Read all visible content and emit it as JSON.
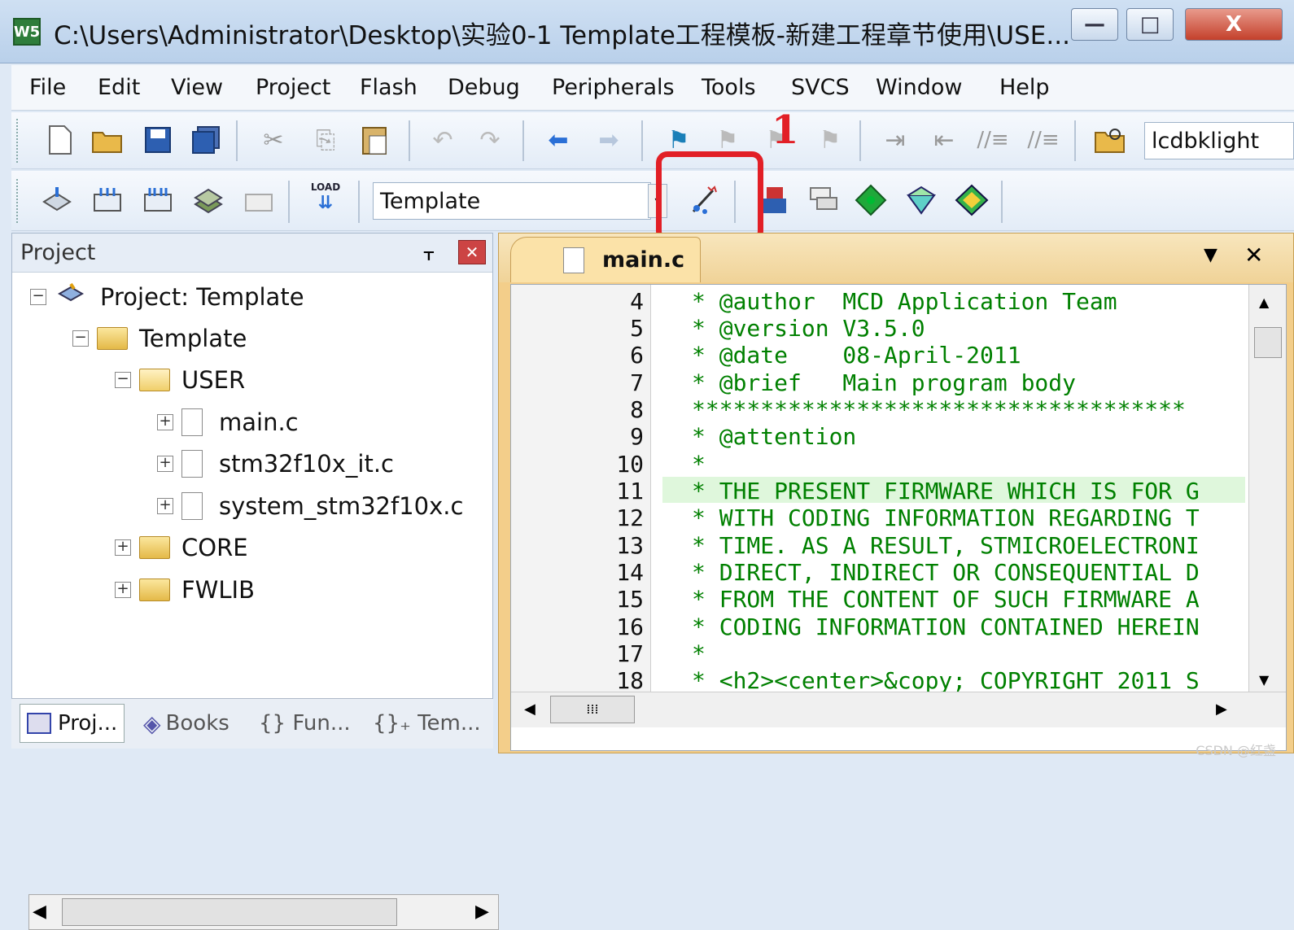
{
  "window": {
    "title": "C:\\Users\\Administrator\\Desktop\\实验0-1 Template工程模板-新建工程章节使用\\USE...",
    "app_icon_label": "W5",
    "minimize": "—",
    "maximize": "□",
    "close": "X"
  },
  "menu": [
    "File",
    "Edit",
    "View",
    "Project",
    "Flash",
    "Debug",
    "Peripherals",
    "Tools",
    "SVCS",
    "Window",
    "Help"
  ],
  "toolbar1": {
    "find_combo_value": "lcdbklight",
    "icons": [
      "new-file",
      "open-folder",
      "save",
      "save-all",
      "cut",
      "copy",
      "paste",
      "undo",
      "redo",
      "nav-back",
      "nav-forward",
      "bookmark-set",
      "bookmark-prev",
      "bookmark-next",
      "bookmark-clear",
      "indent",
      "unindent",
      "comment",
      "uncomment",
      "find-in-files"
    ]
  },
  "toolbar2": {
    "target_combo_value": "Template",
    "load_label": "LOAD",
    "annotation_number": "1",
    "icons": [
      "translate",
      "build",
      "rebuild",
      "batch-build",
      "stop-build",
      "download",
      "target-options",
      "file-extensions",
      "manage-run-time",
      "select-packs",
      "pack-installer",
      "manage-components"
    ]
  },
  "project_panel": {
    "title": "Project",
    "pin": "ᚁ",
    "close": "✕",
    "tree": [
      {
        "label": "Project: Template",
        "expander": "⊟"
      },
      {
        "label": "Template",
        "expander": "⊟"
      },
      {
        "label": "USER",
        "expander": "⊟"
      },
      {
        "label": "main.c",
        "expander": "+"
      },
      {
        "label": "stm32f10x_it.c",
        "expander": "+"
      },
      {
        "label": "system_stm32f10x.c",
        "expander": "+"
      },
      {
        "label": "CORE",
        "expander": "+"
      },
      {
        "label": "FWLIB",
        "expander": "+"
      }
    ],
    "tabs": [
      "Proj...",
      "Books",
      "{} Fun...",
      "{}₊ Tem..."
    ]
  },
  "editor": {
    "tab_label": "main.c",
    "dropdown_glyph": "▼",
    "close_glyph": "✕",
    "line_numbers": [
      "4",
      "5",
      "6",
      "7",
      "8",
      "9",
      "10",
      "11",
      "12",
      "13",
      "14",
      "15",
      "16",
      "17",
      "18"
    ],
    "lines": [
      "* @author  MCD Application Team",
      "* @version V3.5.0",
      "* @date    08-April-2011",
      "* @brief   Main program body",
      "************************************",
      "* @attention",
      "*",
      "* THE PRESENT FIRMWARE WHICH IS FOR G",
      "* WITH CODING INFORMATION REGARDING T",
      "* TIME. AS A RESULT, STMICROELECTRONI",
      "* DIRECT, INDIRECT OR CONSEQUENTIAL D",
      "* FROM THE CONTENT OF SUCH FIRMWARE A",
      "* CODING INFORMATION CONTAINED HEREIN",
      "*",
      "* <h2><center>&copy; COPYRIGHT 2011 S"
    ],
    "highlighted_line": "11"
  },
  "watermark": "CSDN @红盏"
}
